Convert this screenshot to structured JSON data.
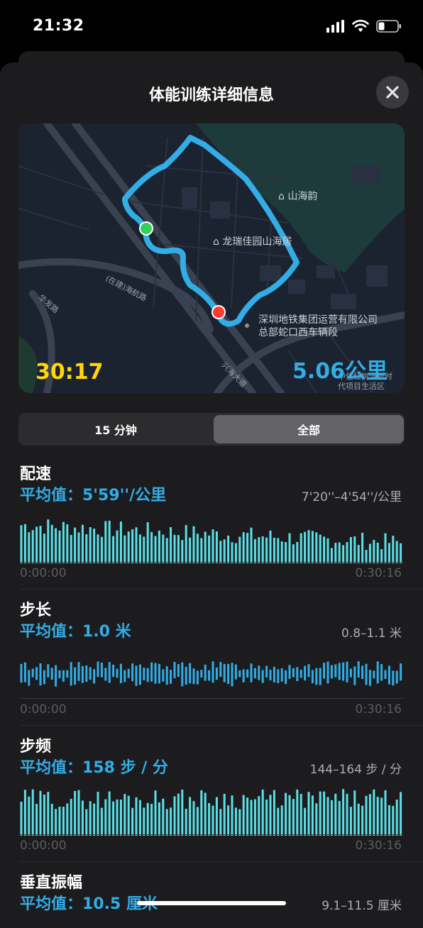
{
  "status": {
    "time": "21:32"
  },
  "sheet": {
    "title": "体能训练详细信息",
    "close_icon": "xmark-icon"
  },
  "map": {
    "labels": {
      "poi1": "山海韵",
      "poi2": "龙瑞佳园山海居",
      "poi3_line1": "深圳地铁集团运营有限公司",
      "poi3_line2": "总部蛇口西车辆段",
      "road1": "(在建)海航路",
      "road2": "华发路",
      "road3": "兴海大道",
      "area_line1": "中信红树湾新时",
      "area_line2": "代项目生活区"
    },
    "duration": "30:17",
    "distance": "5.06公里",
    "route_color": "#32ade6",
    "start_color": "#30d158",
    "end_color": "#ff3b30"
  },
  "segment": {
    "options": [
      "15 分钟",
      "全部"
    ],
    "selected": "全部"
  },
  "metrics": [
    {
      "name": "配速",
      "avg": "平均值：5'59''/公里",
      "range": "7'20''–4'54''/公里",
      "start": "0:00:00",
      "end": "0:30:16",
      "color": "#5ae0e6"
    },
    {
      "name": "步长",
      "avg": "平均值：1.0 米",
      "range": "0.8–1.1 米",
      "start": "0:00:00",
      "end": "0:30:16",
      "color": "#32ade6"
    },
    {
      "name": "步频",
      "avg": "平均值：158 步 / 分",
      "range": "144–164 步 / 分",
      "start": "0:00:00",
      "end": "0:30:16",
      "color": "#5ae0e6"
    },
    {
      "name": "垂直振幅",
      "avg": "平均值：10.5 厘米",
      "range": "9.1–11.5 厘米"
    }
  ]
}
